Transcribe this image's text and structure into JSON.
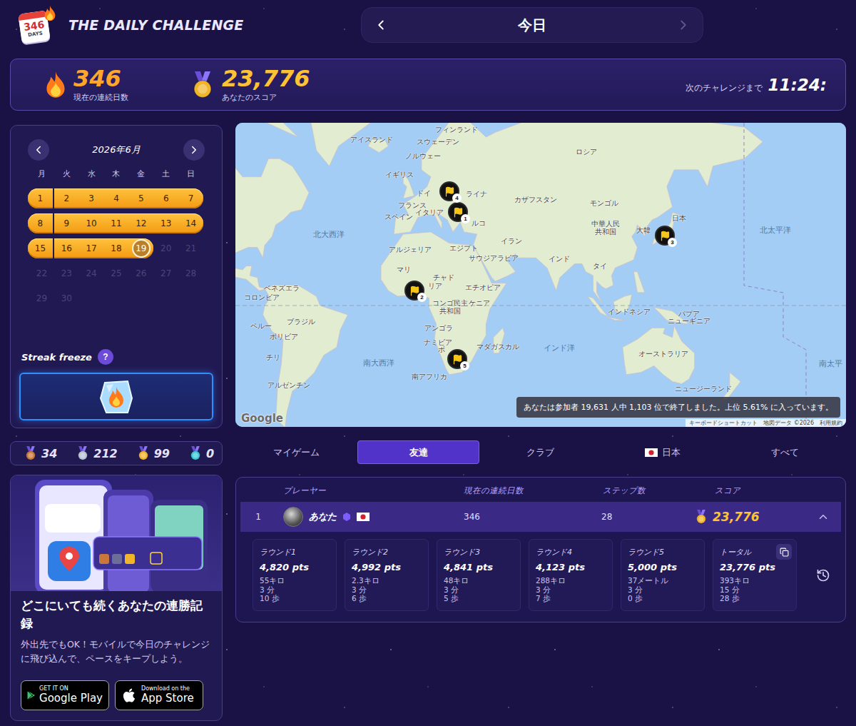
{
  "logo": {
    "number": "346",
    "label": "DAYS"
  },
  "title": "THE DAILY CHALLENGE",
  "date_nav": {
    "label": "今日",
    "prev_disabled": false,
    "next_disabled": true
  },
  "stats": {
    "streak": {
      "value": "346",
      "label": "現在の連続日数"
    },
    "score": {
      "value": "23,776",
      "label": "あなたのスコア"
    },
    "countdown": {
      "label": "次のチャレンジまで",
      "time": "11:24:"
    }
  },
  "calendar": {
    "month": "2026年6月",
    "weekdays": [
      "月",
      "火",
      "水",
      "木",
      "金",
      "土",
      "日"
    ],
    "days": [
      {
        "day": "1",
        "streak": true,
        "today": false,
        "future": false
      },
      {
        "day": "2",
        "streak": true,
        "today": false,
        "future": false
      },
      {
        "day": "3",
        "streak": true,
        "today": false,
        "future": false
      },
      {
        "day": "4",
        "streak": true,
        "today": false,
        "future": false
      },
      {
        "day": "5",
        "streak": true,
        "today": false,
        "future": false
      },
      {
        "day": "6",
        "streak": true,
        "today": false,
        "future": false
      },
      {
        "day": "7",
        "streak": true,
        "today": false,
        "future": false
      },
      {
        "day": "8",
        "streak": true,
        "today": false,
        "future": false
      },
      {
        "day": "9",
        "streak": true,
        "today": false,
        "future": false
      },
      {
        "day": "10",
        "streak": true,
        "today": false,
        "future": false
      },
      {
        "day": "11",
        "streak": true,
        "today": false,
        "future": false
      },
      {
        "day": "12",
        "streak": true,
        "today": false,
        "future": false
      },
      {
        "day": "13",
        "streak": true,
        "today": false,
        "future": false
      },
      {
        "day": "14",
        "streak": true,
        "today": false,
        "future": false
      },
      {
        "day": "15",
        "streak": true,
        "today": false,
        "future": false
      },
      {
        "day": "16",
        "streak": true,
        "today": false,
        "future": false
      },
      {
        "day": "17",
        "streak": true,
        "today": false,
        "future": false
      },
      {
        "day": "18",
        "streak": true,
        "today": false,
        "future": false
      },
      {
        "day": "19",
        "streak": true,
        "today": true,
        "future": false
      },
      {
        "day": "20",
        "streak": false,
        "today": false,
        "future": true
      },
      {
        "day": "21",
        "streak": false,
        "today": false,
        "future": true
      },
      {
        "day": "22",
        "streak": false,
        "today": false,
        "future": true
      },
      {
        "day": "23",
        "streak": false,
        "today": false,
        "future": true
      },
      {
        "day": "24",
        "streak": false,
        "today": false,
        "future": true
      },
      {
        "day": "25",
        "streak": false,
        "today": false,
        "future": true
      },
      {
        "day": "26",
        "streak": false,
        "today": false,
        "future": true
      },
      {
        "day": "27",
        "streak": false,
        "today": false,
        "future": true
      },
      {
        "day": "28",
        "streak": false,
        "today": false,
        "future": true
      },
      {
        "day": "29",
        "streak": false,
        "today": false,
        "future": true
      },
      {
        "day": "30",
        "streak": false,
        "today": false,
        "future": true
      }
    ]
  },
  "streak_freeze": {
    "label": "Streak freeze",
    "help": "?",
    "available": true
  },
  "medals": [
    {
      "count": "34",
      "color": "#c9773a"
    },
    {
      "count": "212",
      "color": "#b9c3d6"
    },
    {
      "count": "99",
      "color": "#f1b52c"
    },
    {
      "count": "0",
      "color": "#3ccad9"
    }
  ],
  "promo": {
    "heading": "どこにいても続くあなたの連勝記録",
    "text": "外出先でもOK！モバイルで今日のチャレンジに飛び込んで、ペースをキープしよう。",
    "stores": [
      {
        "small": "GET IT ON",
        "name": "Google Play",
        "kind": "google"
      },
      {
        "small": "Download on the",
        "name": "App Store",
        "kind": "apple"
      }
    ]
  },
  "map": {
    "labels": [
      {
        "text": "アイスランド",
        "kind": "country"
      },
      {
        "text": "フィンランド",
        "kind": "country"
      },
      {
        "text": "スウェーデン",
        "kind": "country"
      },
      {
        "text": "ノルウェー",
        "kind": "country"
      },
      {
        "text": "ロシア",
        "kind": "country"
      },
      {
        "text": "イギリス",
        "kind": "country"
      },
      {
        "text": "ドイ",
        "kind": "country"
      },
      {
        "text": "ライナ",
        "kind": "country"
      },
      {
        "text": "フランス",
        "kind": "country"
      },
      {
        "text": "イタリア",
        "kind": "country"
      },
      {
        "text": "スペイン",
        "kind": "country"
      },
      {
        "text": "ルコ",
        "kind": "country"
      },
      {
        "text": "カザフスタン",
        "kind": "country"
      },
      {
        "text": "モンゴル",
        "kind": "country"
      },
      {
        "text": "中華人民",
        "kind": "country"
      },
      {
        "text": "共和国",
        "kind": "country"
      },
      {
        "text": "日本",
        "kind": "country"
      },
      {
        "text": "大韓",
        "kind": "country"
      },
      {
        "text": "イラン",
        "kind": "country"
      },
      {
        "text": "エジプト",
        "kind": "country"
      },
      {
        "text": "サウジアラビア",
        "kind": "country"
      },
      {
        "text": "アルジェリア",
        "kind": "country"
      },
      {
        "text": "マリ",
        "kind": "country"
      },
      {
        "text": "チャド",
        "kind": "country"
      },
      {
        "text": "リア",
        "kind": "country"
      },
      {
        "text": "インド",
        "kind": "country"
      },
      {
        "text": "タイ",
        "kind": "country"
      },
      {
        "text": "エチオピア",
        "kind": "country"
      },
      {
        "text": "ケニア",
        "kind": "country"
      },
      {
        "text": "コンゴ民主",
        "kind": "country"
      },
      {
        "text": "共和国",
        "kind": "country"
      },
      {
        "text": "インドネシア",
        "kind": "country"
      },
      {
        "text": "パプア",
        "kind": "country"
      },
      {
        "text": "ニューギニア",
        "kind": "country"
      },
      {
        "text": "アンゴラ",
        "kind": "country"
      },
      {
        "text": "ナミビア",
        "kind": "country"
      },
      {
        "text": "ボ",
        "kind": "country"
      },
      {
        "text": "マダガスカル",
        "kind": "country"
      },
      {
        "text": "南アフリカ",
        "kind": "country"
      },
      {
        "text": "オーストラリア",
        "kind": "country"
      },
      {
        "text": "ニュージーランド",
        "kind": "country"
      },
      {
        "text": "ベネズエラ",
        "kind": "country"
      },
      {
        "text": "コロンビア",
        "kind": "country"
      },
      {
        "text": "ブラジル",
        "kind": "country"
      },
      {
        "text": "ペルー",
        "kind": "country"
      },
      {
        "text": "ボリビア",
        "kind": "country"
      },
      {
        "text": "チリ",
        "kind": "country"
      },
      {
        "text": "アルゼンチン",
        "kind": "country"
      },
      {
        "text": "北大西洋",
        "kind": "ocean"
      },
      {
        "text": "南大西洋",
        "kind": "ocean"
      },
      {
        "text": "インド洋",
        "kind": "ocean"
      },
      {
        "text": "北太平洋",
        "kind": "ocean"
      },
      {
        "text": "南太平",
        "kind": "ocean"
      }
    ],
    "pins": [
      {
        "number": "1"
      },
      {
        "number": "2"
      },
      {
        "number": "3"
      },
      {
        "number": "4"
      },
      {
        "number": "5"
      }
    ],
    "result": "あなたは参加者 19,631 人中 1,103 位で終了しました。上位 5.61% に入っています。",
    "logo": "Google",
    "attribution": [
      "キーボードショートカット",
      "地図データ ©2026",
      "利用規約"
    ]
  },
  "tabs": [
    {
      "label": "マイゲーム",
      "selected": false,
      "kind": "plain"
    },
    {
      "label": "友達",
      "selected": true,
      "kind": "plain"
    },
    {
      "label": "クラブ",
      "selected": false,
      "kind": "plain"
    },
    {
      "label": "日本",
      "selected": false,
      "kind": "country"
    },
    {
      "label": "すべて",
      "selected": false,
      "kind": "plain"
    }
  ],
  "leaderboard": {
    "columns": [
      "プレーヤー",
      "現在の連続日数",
      "ステップ数",
      "スコア"
    ],
    "rows": [
      {
        "rank": "1",
        "name": "あなた",
        "streak": "346",
        "steps": "28",
        "score": "23,776",
        "selected": true,
        "expanded": true,
        "rounds": [
          {
            "title": "ラウンド1",
            "points": "4,820 pts",
            "distance": "55キロ",
            "time": "3 分",
            "steps": "10 歩",
            "kind": "round"
          },
          {
            "title": "ラウンド2",
            "points": "4,992 pts",
            "distance": "2.3キロ",
            "time": "3 分",
            "steps": "6 歩",
            "kind": "round"
          },
          {
            "title": "ラウンド3",
            "points": "4,841 pts",
            "distance": "48キロ",
            "time": "3 分",
            "steps": "5 歩",
            "kind": "round"
          },
          {
            "title": "ラウンド4",
            "points": "4,123 pts",
            "distance": "288キロ",
            "time": "3 分",
            "steps": "7 歩",
            "kind": "round"
          },
          {
            "title": "ラウンド5",
            "points": "5,000 pts",
            "distance": "37メートル",
            "time": "3 分",
            "steps": "0 歩",
            "kind": "round"
          },
          {
            "title": "トータル",
            "points": "23,776 pts",
            "distance": "393キロ",
            "time": "15 分",
            "steps": "28 歩",
            "kind": "total"
          }
        ]
      }
    ]
  }
}
